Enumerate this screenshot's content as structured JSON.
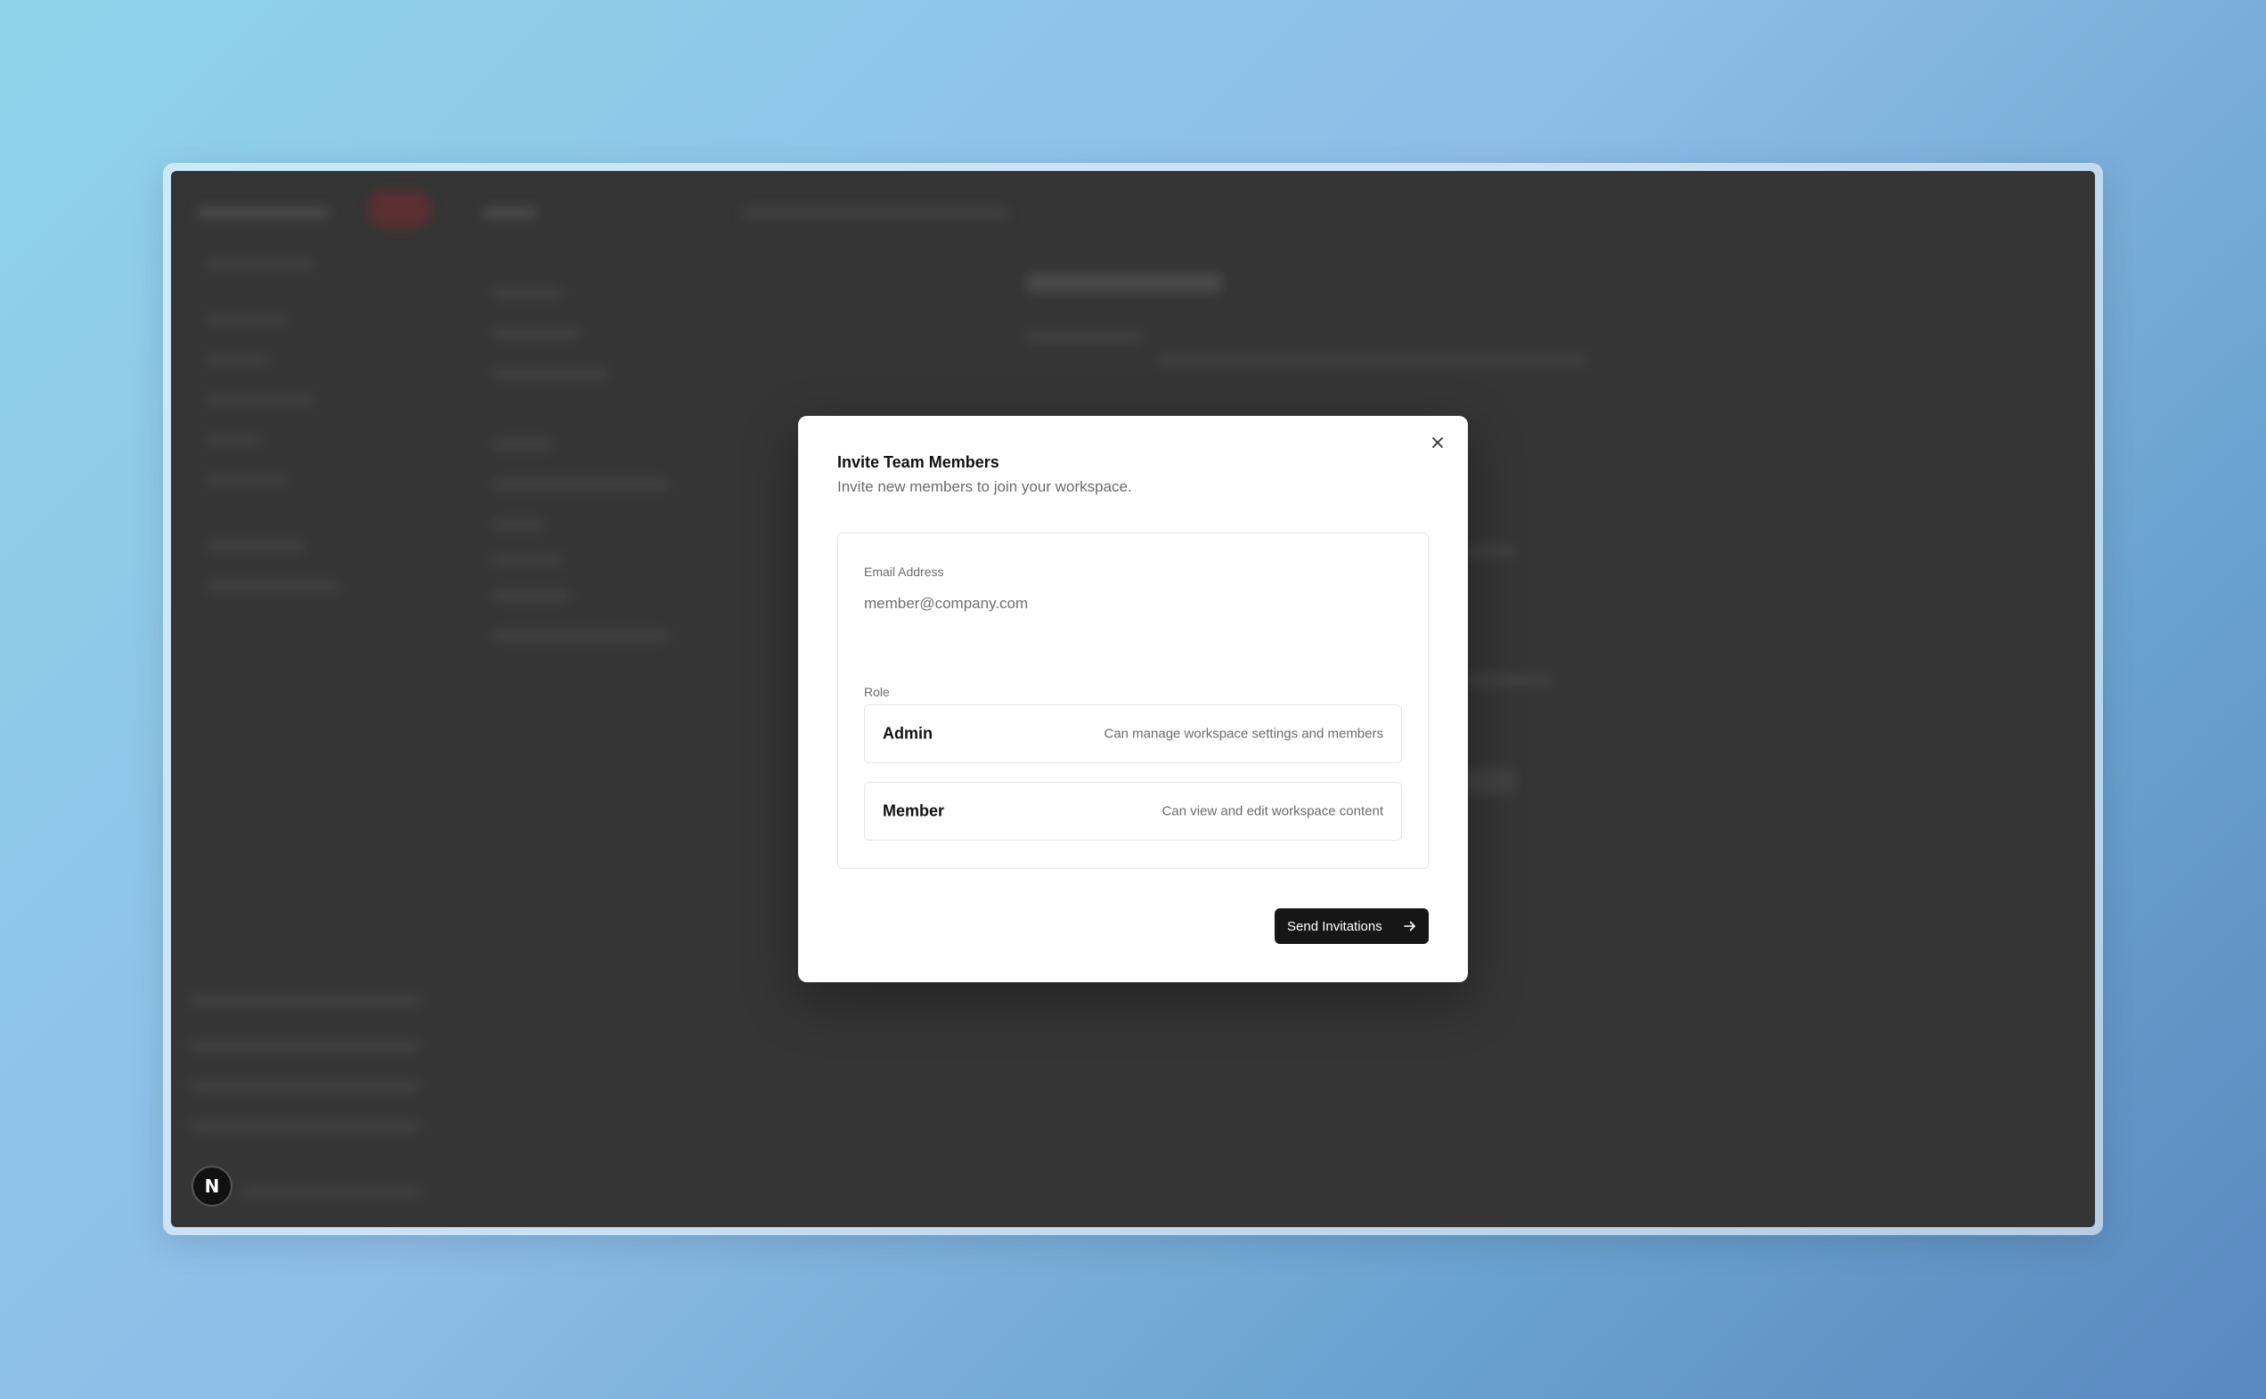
{
  "modal": {
    "title": "Invite Team Members",
    "subtitle": "Invite new members to join your workspace.",
    "close_icon": "close-icon",
    "email": {
      "label": "Email Address",
      "placeholder": "member@company.com",
      "value": ""
    },
    "role": {
      "label": "Role",
      "options": [
        {
          "name": "Admin",
          "description": "Can manage workspace settings and members"
        },
        {
          "name": "Member",
          "description": "Can view and edit workspace content"
        }
      ]
    },
    "submit": {
      "label": "Send Invitations",
      "icon": "arrow-right-icon"
    }
  },
  "dev_badge": {
    "label": "N"
  },
  "colors": {
    "background_gradient_start": "#8fd3ea",
    "background_gradient_end": "#5a88bf",
    "app_background": "#353535",
    "modal_background": "#ffffff",
    "primary_button": "#161616"
  }
}
